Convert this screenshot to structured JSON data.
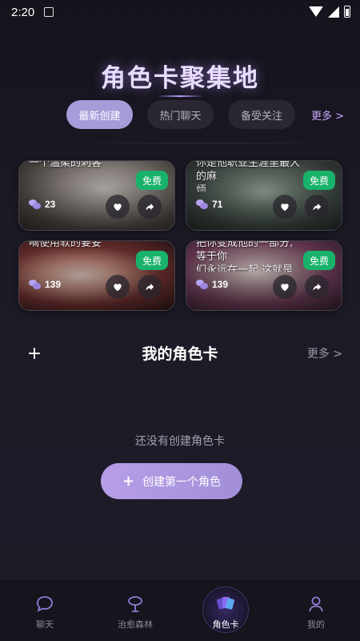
{
  "status_bar": {
    "time": "2:20"
  },
  "header": {
    "title": "角色卡聚集地"
  },
  "tabs": [
    {
      "label": "最新创建",
      "active": true
    },
    {
      "label": "热门聊天",
      "active": false
    },
    {
      "label": "备受关注",
      "active": false
    }
  ],
  "tabs_more": "更多 >",
  "cards": [
    {
      "text": "一个温柔的刺客",
      "badge": "免费",
      "chat_count": "23"
    },
    {
      "text": "你是他职业生涯里最大的麻\n烦",
      "badge": "免费",
      "chat_count": "71"
    },
    {
      "text": "嘀使用软的要妥",
      "badge": "免费",
      "chat_count": "139"
    },
    {
      "text": "把你变成他的一部分,等于你\n们永远在一起,这就是",
      "badge": "免费",
      "chat_count": "139"
    }
  ],
  "my_section": {
    "title": "我的角色卡",
    "more": "更多 >",
    "add": "+"
  },
  "empty_state": {
    "message": "还没有创建角色卡",
    "button": "创建第一个角色",
    "button_icon": "+"
  },
  "bottom_nav": [
    {
      "label": "聊天",
      "icon": "chat-bubble-icon",
      "active": false
    },
    {
      "label": "治愈森林",
      "icon": "tree-icon",
      "active": false
    },
    {
      "label": "角色卡",
      "icon": "cards-icon",
      "active": true
    },
    {
      "label": "我的",
      "icon": "profile-icon",
      "active": false
    }
  ],
  "colors": {
    "accent": "#a79bd9",
    "badge": "#19b26b",
    "title_glow": "#b08cff"
  }
}
